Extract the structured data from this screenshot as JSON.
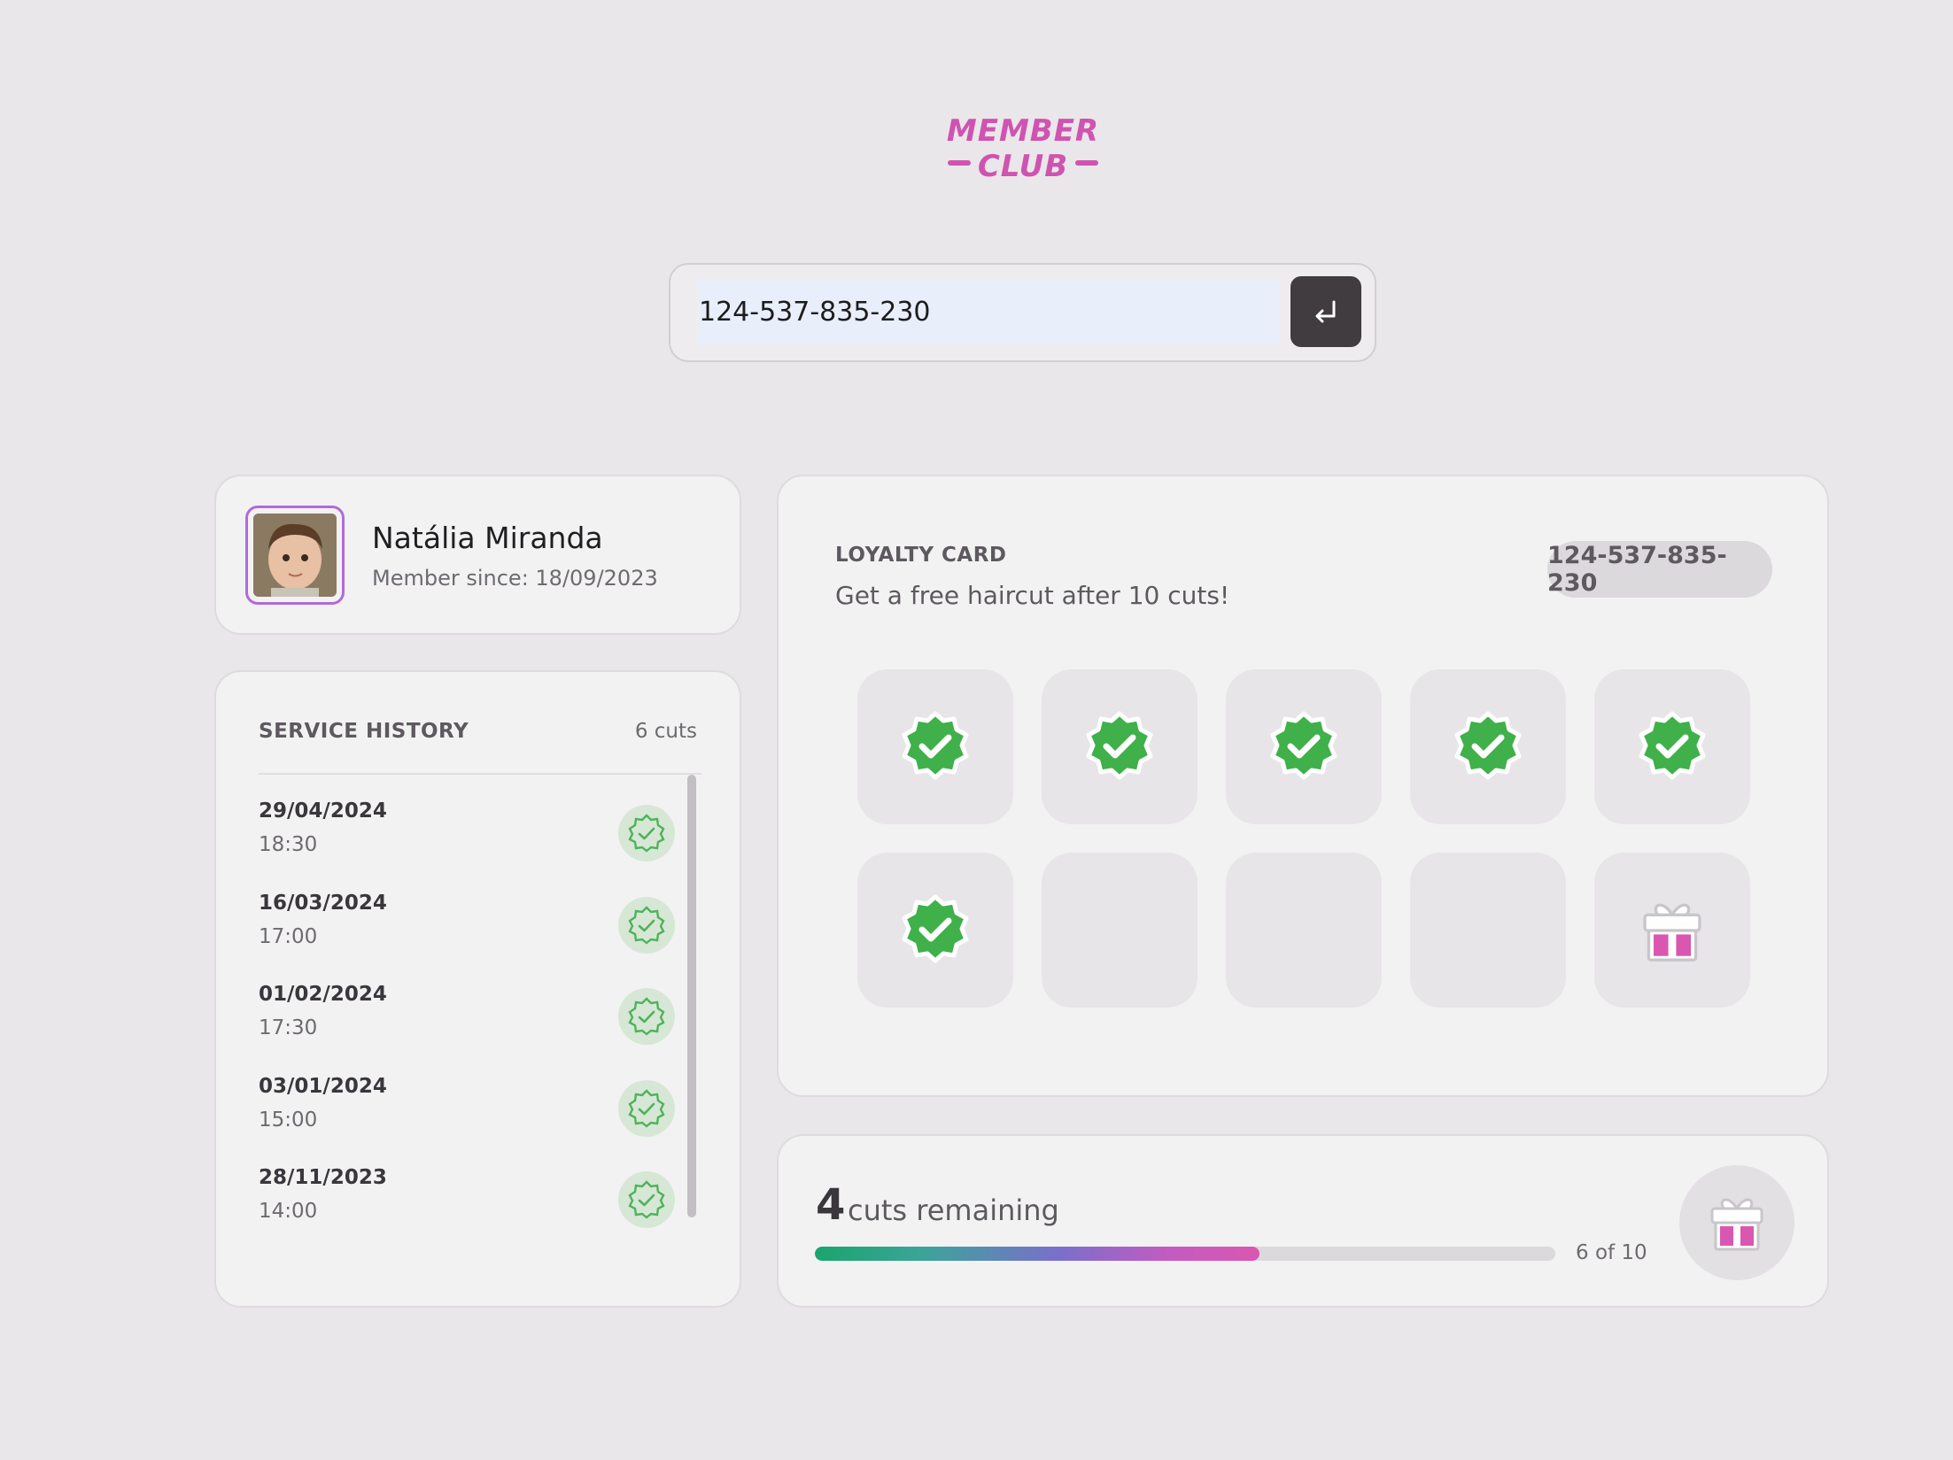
{
  "logo": {
    "line1": "MEMBER",
    "line2": "CLUB"
  },
  "search": {
    "value": "124-537-835-230",
    "submit_icon": "enter-icon"
  },
  "profile": {
    "name": "Natália Miranda",
    "since": "Member since: 18/09/2023",
    "avatar": "avatar-photo"
  },
  "history": {
    "title": "SERVICE HISTORY",
    "count": "6 cuts",
    "items": [
      {
        "date": "29/04/2024",
        "time": "18:30"
      },
      {
        "date": "16/03/2024",
        "time": "17:00"
      },
      {
        "date": "01/02/2024",
        "time": "17:30"
      },
      {
        "date": "03/01/2024",
        "time": "15:00"
      },
      {
        "date": "28/11/2023",
        "time": "14:00"
      }
    ]
  },
  "loyalty": {
    "title": "LOYALTY CARD",
    "subtitle": "Get a free haircut after 10 cuts!",
    "badge": "124-537-835-230",
    "stamps_filled": 6,
    "stamps_total": 10,
    "reward_icon": "gift-icon"
  },
  "progress": {
    "remaining_number": "4",
    "remaining_label": "cuts remaining",
    "fraction": 0.6,
    "of_label": "6 of 10"
  },
  "colors": {
    "brand": "#d053b0",
    "check_green": "#3fb04a",
    "avatar_border": "#b06bd8",
    "enter_button": "#403c3f"
  }
}
